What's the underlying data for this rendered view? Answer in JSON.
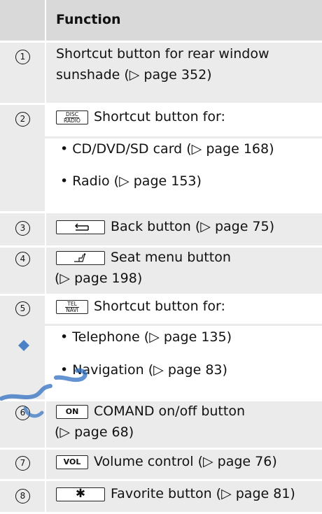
{
  "header": {
    "title": "Function"
  },
  "rows": [
    {
      "num": "1",
      "lines": [
        "Shortcut button for rear window",
        "sunshade (▷ page 352)"
      ]
    },
    {
      "num": "2",
      "key": "DISC/RADIO",
      "key_top": "DISC",
      "key_bottom": "RADIO",
      "text": "Shortcut button for:"
    },
    {
      "bullet_1": "• CD/DVD/SD card (▷ page 168)",
      "bullet_2": "• Radio (▷ page 153)"
    },
    {
      "num": "3",
      "key": "back-arrow",
      "text": "Back button (▷ page 75)"
    },
    {
      "num": "4",
      "key": "seat",
      "lines": [
        "Seat menu button",
        "(▷ page 198)"
      ]
    },
    {
      "num": "5",
      "key_top": "TEL",
      "key_bottom": "NAVI",
      "text": "Shortcut button for:",
      "bullet_1": "• Telephone (▷ page 135)",
      "bullet_2": "• Navigation (▷ page 83)"
    },
    {
      "num": "6",
      "key_label": "ON",
      "lines": [
        "COMAND on/off button",
        "(▷ page 68)"
      ]
    },
    {
      "num": "7",
      "key_label": "VOL",
      "text": "Volume control (▷ page 76)"
    },
    {
      "num": "8",
      "key_label": "✱",
      "text": "Favorite button (▷ page 81)"
    }
  ],
  "colors": {
    "header_bg": "#d9d9d9",
    "row_bg": "#ebebeb",
    "watermark": "#2f6fc0"
  }
}
